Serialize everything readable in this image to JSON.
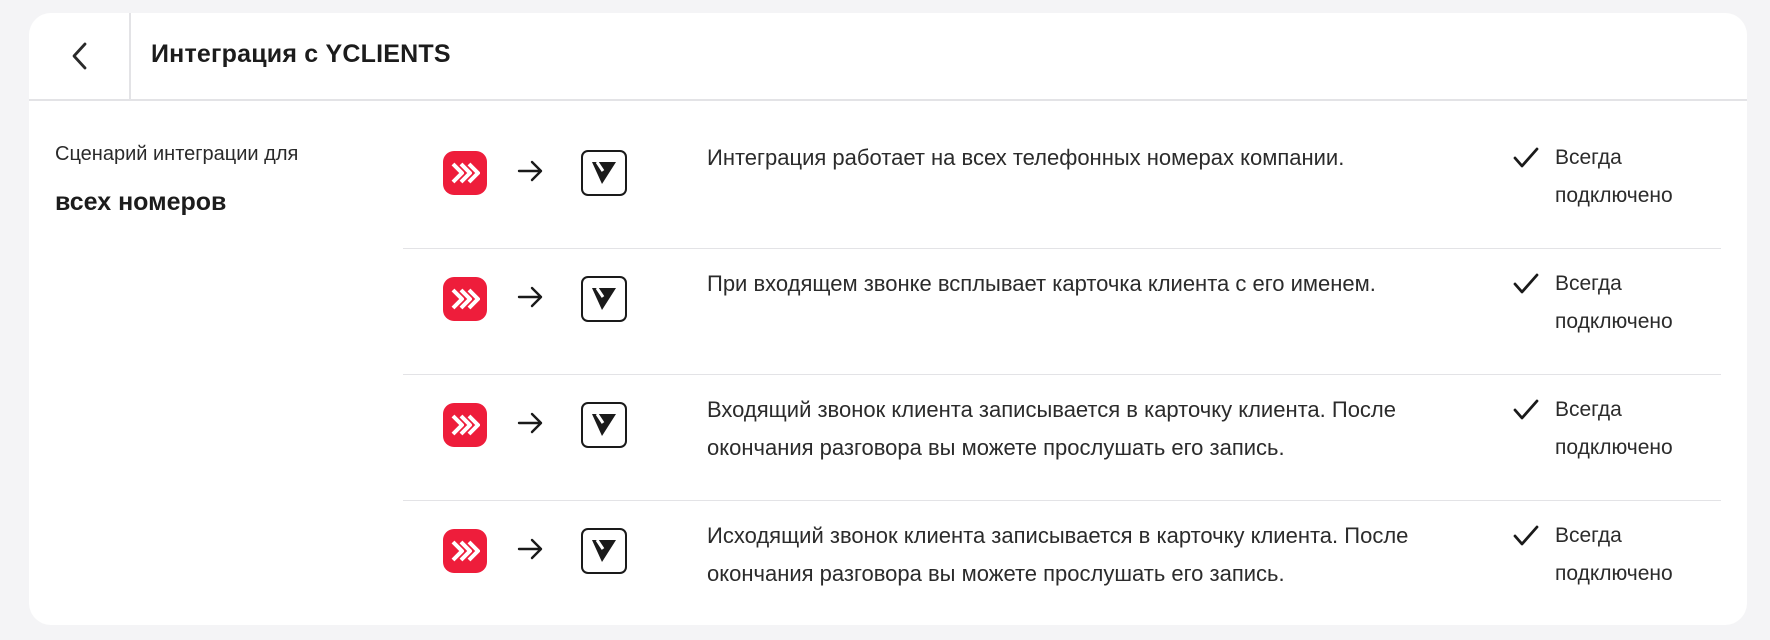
{
  "header": {
    "back_icon": "chevron-left-icon",
    "title": "Интеграция с YCLIENTS"
  },
  "scenario": {
    "caption": "Сценарий интеграции для",
    "target": "всех номеров"
  },
  "colors": {
    "brand_red": "#ee1d3b",
    "divider": "#e3e3e6"
  },
  "rows": [
    {
      "description": "Интеграция работает на всех телефонных номерах компании.",
      "status_line1": "Всегда",
      "status_line2": "подключено"
    },
    {
      "description": "При входящем звонке всплывает карточка клиента с его именем.",
      "status_line1": "Всегда",
      "status_line2": "подключено"
    },
    {
      "description": "Входящий звонок клиента записывается в карточку клиента. После окончания разговора вы можете прослушать его запись.",
      "status_line1": "Всегда",
      "status_line2": "подключено"
    },
    {
      "description": "Исходящий звонок клиента записывается в карточку клиента. После окончания разговора вы можете прослушать его запись.",
      "status_line1": "Всегда",
      "status_line2": "подключено"
    }
  ]
}
